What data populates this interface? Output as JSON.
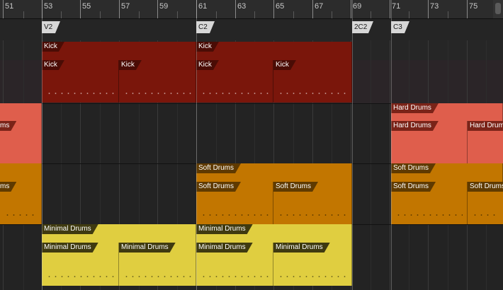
{
  "ruler": {
    "labels": [
      "51",
      "53",
      "55",
      "57",
      "59",
      "61",
      "63",
      "65",
      "67",
      "69",
      "71",
      "73",
      "75"
    ]
  },
  "markers": [
    "V2",
    "C2",
    "2C2",
    "C3"
  ],
  "tracks": {
    "kick": {
      "color": "#7a160b",
      "tab_color": "#4a0c05",
      "arrangement_clips": [
        "Kick",
        "Kick"
      ],
      "session_clips": [
        "Kick",
        "Kick",
        "Kick",
        "Kick"
      ]
    },
    "hard_drums": {
      "color": "#df5e4c",
      "tab_color": "#7a2318",
      "arrangement_clips": [
        "Hard Drums"
      ],
      "session_clips": [
        "Hard Drums",
        "Hard Drums"
      ],
      "left_partial": "ms"
    },
    "soft_drums": {
      "color": "#c27600",
      "tab_color": "#5f3a00",
      "arrangement_clips": [
        "Soft Drums",
        "Soft Drums"
      ],
      "session_clips": [
        "Soft Drums",
        "Soft Drums",
        "Soft Drums",
        "Soft Drums"
      ],
      "left_partial": "ms"
    },
    "minimal_drums": {
      "color": "#e0ce40",
      "tab_color": "#3f3a10",
      "arrangement_clips": [
        "Minimal Drums",
        "Minimal Drums"
      ],
      "session_clips": [
        "Minimal Drums",
        "Minimal Drums",
        "Minimal Drums",
        "Minimal Drums"
      ]
    }
  },
  "colors": {
    "background": "#232323",
    "ruler": "#2c2c2c",
    "marker": "#d7d7d7"
  }
}
